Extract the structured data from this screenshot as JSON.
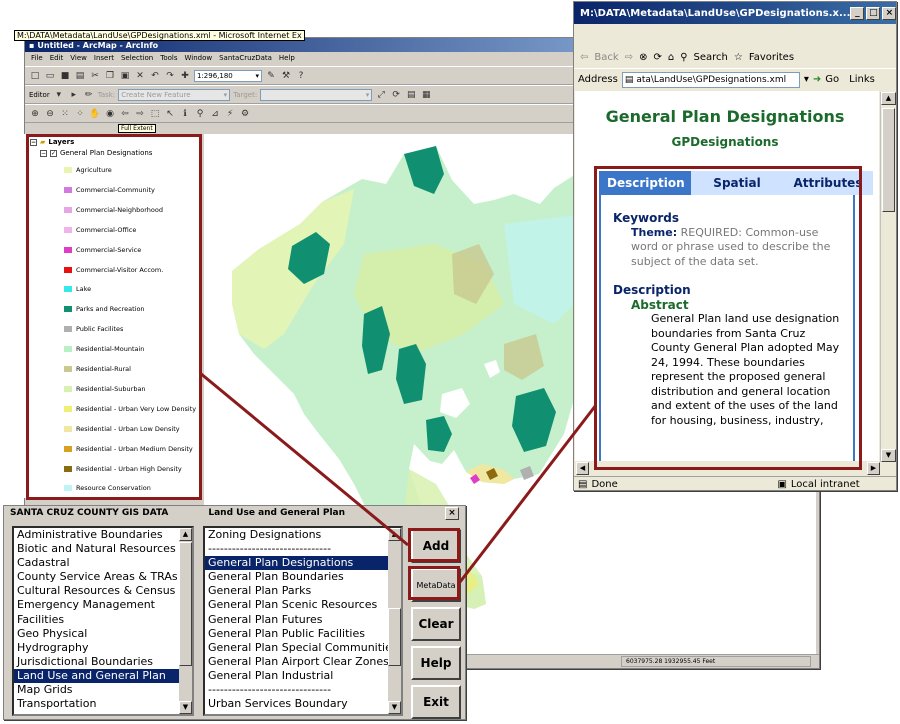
{
  "arcmap": {
    "title": "Untitled - ArcMap - ArcInfo",
    "menu": [
      "File",
      "Edit",
      "View",
      "Insert",
      "Selection",
      "Tools",
      "Window",
      "SantaCruzData",
      "Help"
    ],
    "scale": "1:296,180",
    "editor_label": "Editor",
    "task_label": "Task:",
    "task_value": "Create New Feature",
    "target_label": "Target:",
    "tooltip": "Full Extent",
    "toc": {
      "root": "Layers",
      "layer": "General Plan Designations",
      "legend": [
        {
          "label": "Agriculture",
          "color": "#e8f5b0"
        },
        {
          "label": "Commercial-Community",
          "color": "#d27ae0"
        },
        {
          "label": "Commercial-Neighborhood",
          "color": "#e6a6e6"
        },
        {
          "label": "Commercial-Office",
          "color": "#f0b4e8"
        },
        {
          "label": "Commercial-Service",
          "color": "#e03cc8"
        },
        {
          "label": "Commercial-Visitor Accom.",
          "color": "#e81010"
        },
        {
          "label": "Lake",
          "color": "#38e8e8"
        },
        {
          "label": "Parks and Recreation",
          "color": "#109070"
        },
        {
          "label": "Public Facilites",
          "color": "#b0b0b0"
        },
        {
          "label": "Residential-Mountain",
          "color": "#b8f0c4"
        },
        {
          "label": "Residential-Rural",
          "color": "#c8c890"
        },
        {
          "label": "Residential-Suburban",
          "color": "#d8f0b0"
        },
        {
          "label": "Residential - Urban Very Low Density",
          "color": "#f0f070"
        },
        {
          "label": "Residential - Urban Low Density",
          "color": "#f0e8a0"
        },
        {
          "label": "Residential - Urban Medium Density",
          "color": "#d8a020"
        },
        {
          "label": "Residential - Urban High Density",
          "color": "#8c6a10"
        },
        {
          "label": "Resource Conservation",
          "color": "#c0f4f4"
        }
      ]
    },
    "status_coords": "6037975.28  1932955.45 Feet"
  },
  "ie": {
    "title": "M:\\DATA\\Metadata\\LandUse\\GPDesignations.x...",
    "tooltip": "M:\\DATA\\Metadata\\LandUse\\GPDesignations.xml - Microsoft Internet Ex",
    "back": "Back",
    "search": "Search",
    "favorites": "Favorites",
    "address_label": "Address",
    "address_value": "ata\\LandUse\\GPDesignations.xml",
    "go": "Go",
    "links": "Links",
    "status_done": "Done",
    "status_zone": "Local intranet",
    "doc": {
      "title": "General Plan Designations",
      "subtitle": "GPDesignations",
      "tabs": [
        "Description",
        "Spatial",
        "Attributes"
      ],
      "keywords_h": "Keywords",
      "theme_label": "Theme:",
      "theme_text": "REQUIRED: Common-use word or phrase used to describe the subject of the data set.",
      "description_h": "Description",
      "abstract_h": "Abstract",
      "abstract_text": "General Plan land use designation boundaries from Santa Cruz County General Plan adopted May 24, 1994. These boundaries represent the proposed general distribution and general location and extent of the uses of the land for housing, business, industry,"
    }
  },
  "dialog": {
    "title_left": "SANTA CRUZ COUNTY GIS DATA",
    "title_right": "Land Use and General Plan",
    "categories": [
      "Administrative Boundaries",
      "Biotic and Natural Resources",
      "Cadastral",
      "County Service Areas & TRAs",
      "Cultural Resources & Census",
      "Emergency Management",
      "Facilities",
      "Geo Physical",
      "Hydrography",
      "Jurisdictional Boundaries",
      "Land Use and General Plan",
      "Map Grids",
      "Transportation"
    ],
    "selected_category": 10,
    "layers": [
      "Zoning Designations",
      "-------------------------------",
      "General Plan Designations",
      "General Plan Boundaries",
      "General Plan Parks",
      "General Plan Scenic Resources",
      "General Plan Futures",
      "General Plan Public Facilities",
      "General Plan Special Communities",
      "General Plan Airport Clear Zones",
      "General Plan Industrial",
      "-------------------------------",
      "Urban Services Boundary"
    ],
    "selected_layer": 2,
    "buttons": {
      "add": "Add",
      "metadata": "MetaData",
      "clear": "Clear",
      "help": "Help",
      "exit": "Exit"
    }
  }
}
